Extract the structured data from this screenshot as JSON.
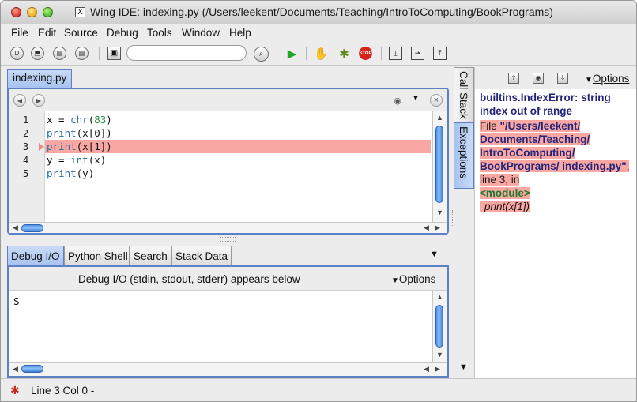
{
  "window": {
    "title": "Wing IDE: indexing.py (/Users/leekent/Documents/Teaching/IntroToComputing/BookPrograms)",
    "x11_glyph": "X"
  },
  "menu": [
    "File",
    "Edit",
    "Source",
    "Debug",
    "Tools",
    "Window",
    "Help"
  ],
  "toolbar": {
    "icons": [
      "new-file-icon",
      "open-file-icon",
      "save-icon",
      "save-all-icon",
      "toggle-panel-icon",
      "search-go-icon",
      "run-icon",
      "pause-icon",
      "debug-icon",
      "stop-icon",
      "step-into-icon",
      "step-over-icon",
      "step-out-icon"
    ],
    "search_value": "",
    "stop_label": "STOP"
  },
  "editor": {
    "tab_label": "indexing.py",
    "lines": [
      {
        "num": "1",
        "code": "x = chr(83)"
      },
      {
        "num": "2",
        "code": "print(x[0])"
      },
      {
        "num": "3",
        "code": "print(x[1])"
      },
      {
        "num": "4",
        "code": "y = int(x)"
      },
      {
        "num": "5",
        "code": "print(y)"
      }
    ],
    "current_line": 3,
    "close_glyph": "×"
  },
  "bottom": {
    "tabs": [
      "Debug I/O",
      "Python Shell",
      "Search",
      "Stack Data"
    ],
    "active_tab": "Debug I/O",
    "header": "Debug I/O (stdin, stdout, stderr) appears below",
    "options_label": "Options",
    "output": "S"
  },
  "side_tabs": [
    "Call Stack",
    "Exceptions"
  ],
  "exceptions": {
    "options_label": "Options",
    "error_title": "builtins.IndexError: string index out of range",
    "file_prefix": "File ",
    "file_path": "\"/Users/leekent/ Documents/Teaching/ IntroToComputing/ BookPrograms/ indexing.py\"",
    "line_info": ", line 3, in",
    "module": "<module>",
    "code": "print(x[1])"
  },
  "status": {
    "text": "Line 3 Col 0 -"
  },
  "colors": {
    "accent": "#5d7fc4",
    "highlight": "#f8a7a3",
    "run_green": "#1fa81f",
    "stop_red": "#d8231b"
  }
}
